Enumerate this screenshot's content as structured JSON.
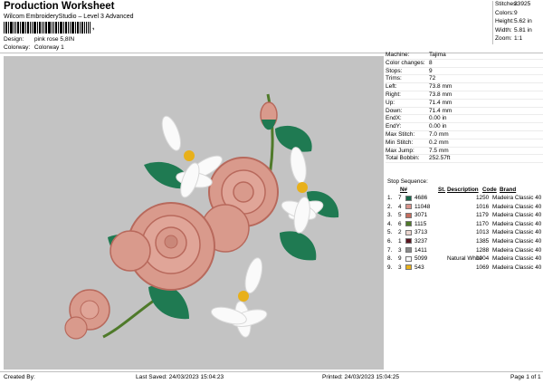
{
  "header": {
    "title": "Production Worksheet",
    "software": "Wilcom EmbroideryStudio – Level 3 Advanced",
    "barcode_suffix": ",",
    "design_label": "Design:",
    "design_value": "pink rose 5,8IN",
    "colorway_label": "Colorway:",
    "colorway_value": "Colorway 1"
  },
  "stats": [
    {
      "label": "Stitches:",
      "value": "33925"
    },
    {
      "label": "Colors:",
      "value": "9"
    },
    {
      "label": "Height:",
      "value": "5.62 in"
    },
    {
      "label": "Width:",
      "value": "5.81 in"
    },
    {
      "label": "Zoom:",
      "value": "1:1"
    }
  ],
  "machine_info": [
    {
      "label": "Machine:",
      "value": "Tajima"
    },
    {
      "label": "Color changes:",
      "value": "8"
    },
    {
      "label": "Stops:",
      "value": "9"
    },
    {
      "label": "Trims:",
      "value": "72"
    },
    {
      "label": "Left:",
      "value": "73.8 mm"
    },
    {
      "label": "Right:",
      "value": "73.8 mm"
    },
    {
      "label": "Up:",
      "value": "71.4 mm"
    },
    {
      "label": "Down:",
      "value": "71.4 mm"
    },
    {
      "label": "EndX:",
      "value": "0.00 in"
    },
    {
      "label": "EndY:",
      "value": "0.00 in"
    },
    {
      "label": "Max Stitch:",
      "value": "7.0 mm"
    },
    {
      "label": "Min Stitch:",
      "value": "0.2 mm"
    },
    {
      "label": "Max Jump:",
      "value": "7.5 mm"
    },
    {
      "label": "Total Bobbin:",
      "value": "252.57ft"
    }
  ],
  "stop_sequence": {
    "title": "Stop Sequence:",
    "columns": {
      "n": "N#",
      "st": "St.",
      "description": "Description",
      "code": "Code",
      "brand": "Brand"
    },
    "rows": [
      {
        "stop": "1.",
        "n": "7",
        "color": "#16684a",
        "code_num": "4686",
        "st": "1250",
        "description": "",
        "code": "Madeira Classic 40"
      },
      {
        "stop": "2.",
        "n": "4",
        "color": "#d9938b",
        "code_num": "11048",
        "st": "1016",
        "description": "",
        "code": "Madeira Classic 40"
      },
      {
        "stop": "3.",
        "n": "5",
        "color": "#c46d5e",
        "code_num": "3071",
        "st": "1179",
        "description": "",
        "code": "Madeira Classic 40"
      },
      {
        "stop": "4.",
        "n": "6",
        "color": "#4f7a2a",
        "code_num": "1115",
        "st": "1170",
        "description": "",
        "code": "Madeira Classic 40"
      },
      {
        "stop": "5.",
        "n": "2",
        "color": "#ecd6cf",
        "code_num": "3713",
        "st": "1013",
        "description": "",
        "code": "Madeira Classic 40"
      },
      {
        "stop": "6.",
        "n": "1",
        "color": "#5a1620",
        "code_num": "3237",
        "st": "1385",
        "description": "",
        "code": "Madeira Classic 40"
      },
      {
        "stop": "7.",
        "n": "3",
        "color": "#8a8a8a",
        "code_num": "1411",
        "st": "1288",
        "description": "",
        "code": "Madeira Classic 40"
      },
      {
        "stop": "8.",
        "n": "9",
        "color": "#f7f7f7",
        "code_num": "5099",
        "st": "1004",
        "description": "Natural White",
        "code": "Madeira Classic 40"
      },
      {
        "stop": "9.",
        "n": "3",
        "color": "#e8b01a",
        "code_num": "543",
        "st": "1069",
        "description": "",
        "code": "Madeira Classic 40"
      }
    ]
  },
  "footer": {
    "created_by": "Created By:",
    "last_saved": "Last Saved: 24/03/2023 15:04:23",
    "printed": "Printed: 24/03/2023 15:04:25",
    "page": "Page 1 of 1"
  },
  "colors": {
    "design_background": "#c3c3c3",
    "rose": "#d99a8c",
    "rose_dark": "#b8695c",
    "leaf": "#1f7a52",
    "petal_white": "#fafafa",
    "stamen": "#e8b01a"
  },
  "design_image": {
    "subject": "embroidery design of pink roses with green leaves and white flowers"
  }
}
